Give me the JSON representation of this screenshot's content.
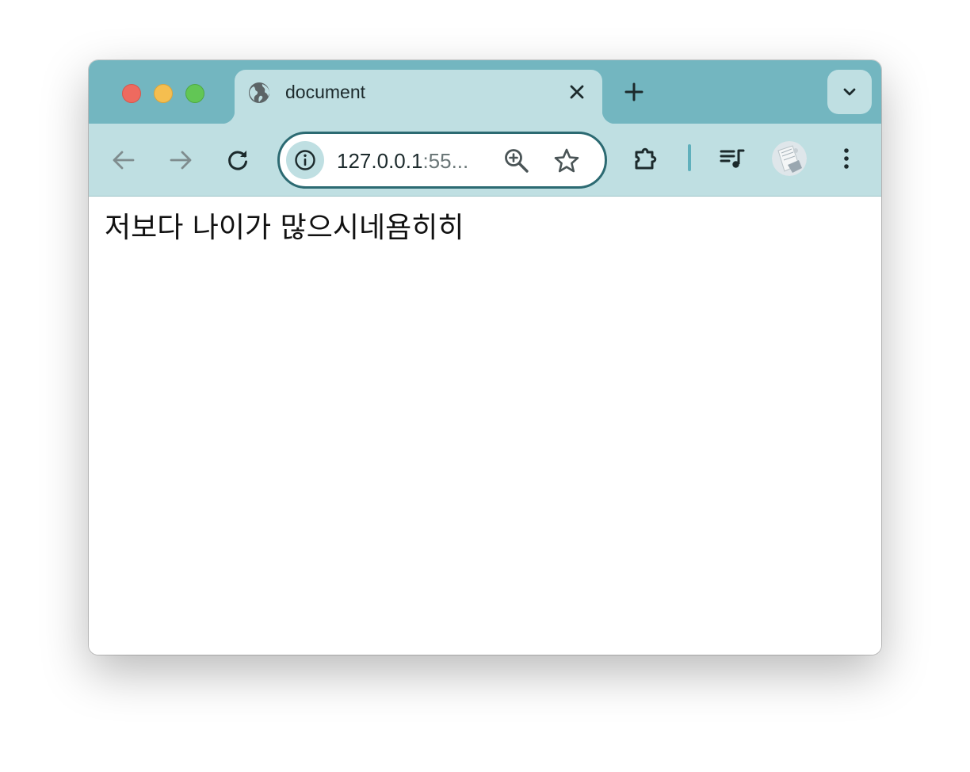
{
  "browser": {
    "window_controls": {
      "close_color": "#ee6a5f",
      "minimize_color": "#f5be4f",
      "maximize_color": "#62c655"
    },
    "tabs": [
      {
        "title": "document",
        "favicon": "globe-icon",
        "active": true
      }
    ],
    "new_tab_icon": "plus-icon",
    "tab_search_icon": "chevron-down-icon",
    "toolbar": {
      "back_icon": "arrow-left-icon",
      "forward_icon": "arrow-right-icon",
      "reload_icon": "reload-icon",
      "address_bar": {
        "site_info_icon": "info-icon",
        "url_host": "127.0.0.1",
        "url_rest": ":55...",
        "zoom_icon": "zoom-in-icon",
        "bookmark_icon": "star-icon"
      },
      "extensions_icon": "puzzle-icon",
      "media_icon": "media-queue-icon",
      "profile_icon": "avatar",
      "menu_icon": "kebab-menu-icon"
    },
    "theme_colors": {
      "tab_strip": "#73b6c0",
      "toolbar": "#bfdfe2",
      "omnibox_border": "#2c6a72"
    }
  },
  "page": {
    "text": "저보다 나이가 많으시네욤히히"
  }
}
